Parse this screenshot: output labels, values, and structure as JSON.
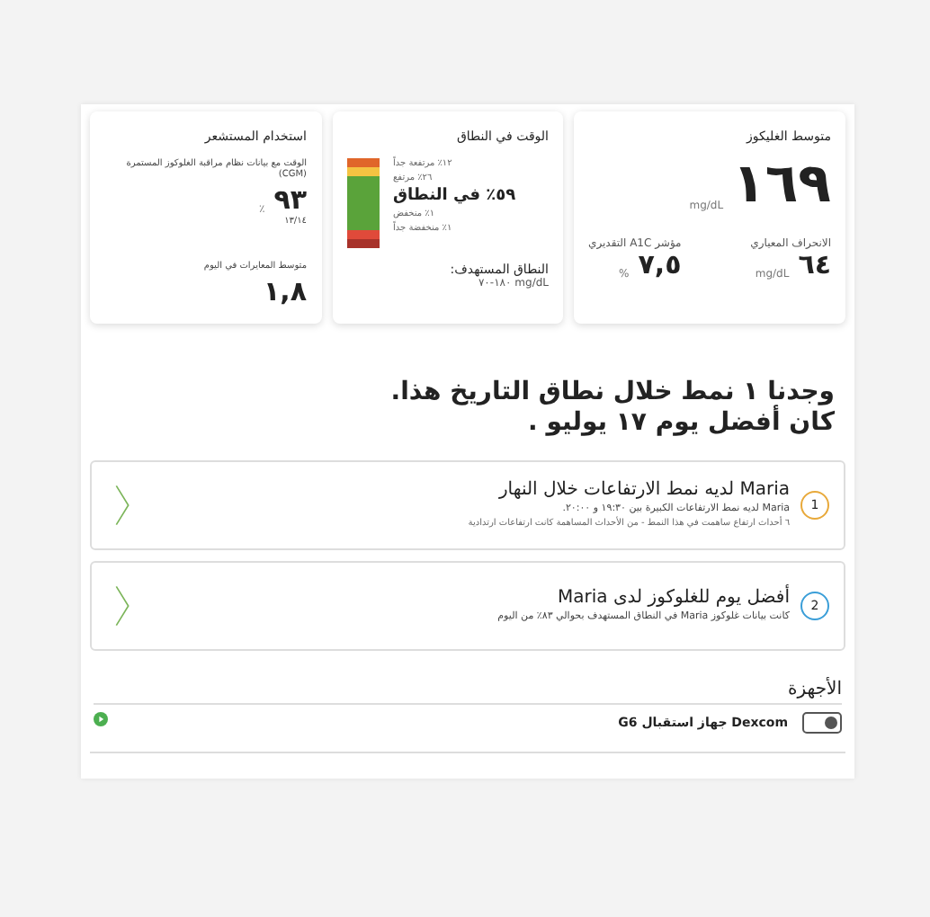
{
  "glucose": {
    "title": "متوسط الغليكوز",
    "value": "١٦٩",
    "unit": "mg/dL",
    "stats": [
      {
        "label": "الانحراف المعياري",
        "value": "٦٤",
        "unit": "mg/dL"
      },
      {
        "label": "مؤشر A1C التقديري",
        "value": "٧,٥",
        "unit": "%"
      }
    ]
  },
  "time_in_range": {
    "title": "الوقت في النطاق",
    "ranges": [
      {
        "label": "١٢٪ مرتفعة جداً",
        "color": "#e0662a",
        "main": false
      },
      {
        "label": "٢٦٪ مرتفع",
        "color": "#f5c342",
        "main": false
      },
      {
        "label": "٥٩٪ في النطاق",
        "color": "#5aa33a",
        "main": true
      },
      {
        "label": "١٪ منخفض",
        "color": "#e04a3a",
        "main": false
      },
      {
        "label": "١٪ منخفضة جداً",
        "color": "#a8322a",
        "main": false
      }
    ],
    "target_label": "النطاق المستهدف:",
    "target_value": "mg/dL ١٨٠-٧٠"
  },
  "sensor": {
    "title": "استخدام المستشعر",
    "subtitle": "الوقت مع بيانات نظام مراقبة الغلوكوز المستمرة (CGM)",
    "value": "٩٣",
    "unit": "٪",
    "days": "١٣/١٤",
    "cal_label": "متوسط المعايرات في اليوم",
    "cal_value": "١,٨"
  },
  "heading": [
    "وجدنا ١ نمط خلال نطاق التاريخ هذا.",
    "كان أفضل يوم ١٧ يوليو ."
  ],
  "insights": [
    {
      "number": "1",
      "color": "#e8a93a",
      "title": "Maria لديه نمط الارتفاعات خلال النهار",
      "lines": [
        "Maria لديه نمط الارتفاعات الكبيرة بين ١٩:٣٠ و ٢٠:٠٠.",
        "٦ أحداث ارتفاع ساهمت في هذا النمط - من الأحداث المساهمة كانت ارتفاعات ارتدادية"
      ]
    },
    {
      "number": "2",
      "color": "#3a9ed8",
      "title": "أفضل يوم للغلوكوز لدى Maria",
      "lines": [
        "كانت بيانات غلوكوز Maria في النطاق المستهدف بحوالي ٨٣٪ من اليوم"
      ]
    }
  ],
  "devices": {
    "title": "الأجهزة",
    "items": [
      {
        "name": "Dexcom جهاز استقبال G6"
      }
    ]
  }
}
